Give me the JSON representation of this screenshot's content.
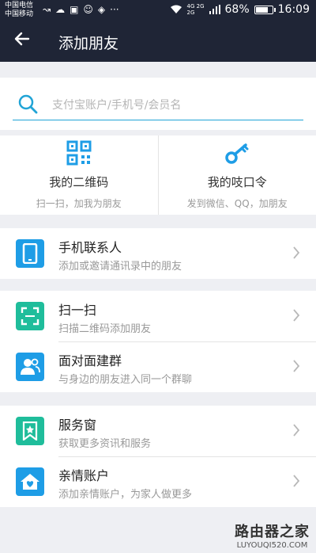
{
  "status_bar": {
    "carrier_1": "中国电信",
    "carrier_2": "中国移动",
    "notifs": [
      "↝",
      "☁",
      "▣",
      "☺",
      "◈",
      "···"
    ],
    "net_1": "4G",
    "net_2": "2G",
    "net_3": "2G",
    "battery_text": "68%",
    "battery_level": 0.68,
    "time": "16:09"
  },
  "header": {
    "back_icon": "arrow-left",
    "title": "添加朋友"
  },
  "search": {
    "placeholder": "支付宝账户/手机号/会员名",
    "icon": "search-icon"
  },
  "quick": [
    {
      "title": "我的二维码",
      "subtitle": "扫一扫，加我为朋友",
      "icon": "qrcode-icon"
    },
    {
      "title": "我的吱口令",
      "subtitle": "发到微信、QQ，加朋友",
      "icon": "key-icon"
    }
  ],
  "groups": [
    {
      "rows": [
        {
          "title": "手机联系人",
          "subtitle": "添加或邀请通讯录中的朋友",
          "icon": "phone-icon",
          "color": "#1e9de6"
        }
      ]
    },
    {
      "rows": [
        {
          "title": "扫一扫",
          "subtitle": "扫描二维码添加朋友",
          "icon": "scan-icon",
          "color": "#1fbd9b"
        },
        {
          "title": "面对面建群",
          "subtitle": "与身边的朋友进入同一个群聊",
          "icon": "group-icon",
          "color": "#1e9de6"
        }
      ]
    },
    {
      "rows": [
        {
          "title": "服务窗",
          "subtitle": "获取更多资讯和服务",
          "icon": "bookmark-icon",
          "color": "#1fbd9b"
        },
        {
          "title": "亲情账户",
          "subtitle": "添加亲情账户，为家人做更多",
          "icon": "home-heart-icon",
          "color": "#1e9de6"
        }
      ]
    }
  ],
  "watermark": {
    "line1": "路由器之家",
    "line2": "LUYOUQI520.COM"
  },
  "colors": {
    "header_bg": "#1f2536",
    "accent": "#21a4d6",
    "blue": "#1e9de6",
    "green": "#1fbd9b"
  }
}
